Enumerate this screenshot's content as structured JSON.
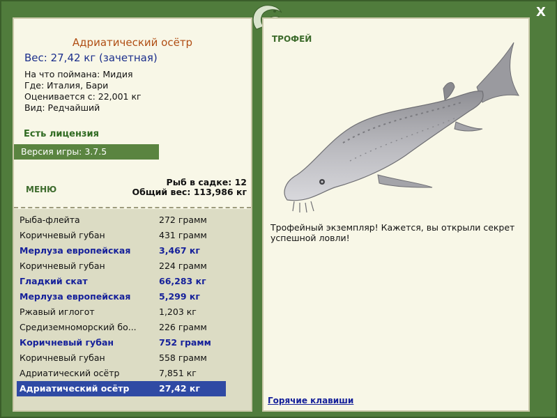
{
  "window": {
    "close_label": "X"
  },
  "fish": {
    "title": "Адриатический осётр",
    "weight": "Вес: 27,42 кг (зачетная)",
    "details": [
      "На что поймана: Мидия",
      "Где: Италия, Бари",
      "Оценивается с: 22,001 кг",
      "Вид: Редчайший"
    ]
  },
  "license": "Есть лицензия",
  "version": "Версия игры: 3.7.5",
  "menu_label": "МЕНЮ",
  "stats": {
    "fish_count": "Рыб в садке: 12",
    "total_weight": "Общий вес: 113,986 кг"
  },
  "catch_list": [
    {
      "name": "Рыба-флейта",
      "weight": "272 грамм",
      "style": "normal"
    },
    {
      "name": "Коричневый губан",
      "weight": "431 грамм",
      "style": "normal"
    },
    {
      "name": "Мерлуза европейская",
      "weight": "3,467 кг",
      "style": "highlight"
    },
    {
      "name": "Коричневый губан",
      "weight": "224 грамм",
      "style": "normal"
    },
    {
      "name": "Гладкий скат",
      "weight": "66,283 кг",
      "style": "highlight"
    },
    {
      "name": "Мерлуза европейская",
      "weight": "5,299 кг",
      "style": "highlight"
    },
    {
      "name": "Ржавый иглогот",
      "weight": "1,203 кг",
      "style": "normal"
    },
    {
      "name": "Средиземноморский бо...",
      "weight": "226 грамм",
      "style": "normal"
    },
    {
      "name": "Коричневый губан",
      "weight": "752 грамм",
      "style": "highlight"
    },
    {
      "name": "Коричневый губан",
      "weight": "558 грамм",
      "style": "normal"
    },
    {
      "name": "Адриатический осётр",
      "weight": "7,851 кг",
      "style": "normal"
    },
    {
      "name": "Адриатический осётр",
      "weight": "27,42 кг",
      "style": "selected"
    }
  ],
  "trophy": {
    "label": "ТРОФЕЙ",
    "text": "Трофейный экземпляр! Кажется, вы открыли секрет успешной ловли!"
  },
  "hotkeys_label": "Горячие клавиши",
  "colors": {
    "frame_green": "#507c3c",
    "panel_bg": "#f8f7e7",
    "list_bg": "#dcdcc4",
    "title_orange": "#b04e14",
    "highlight_blue": "#16219a",
    "selected_bg": "#2f4aa4"
  }
}
